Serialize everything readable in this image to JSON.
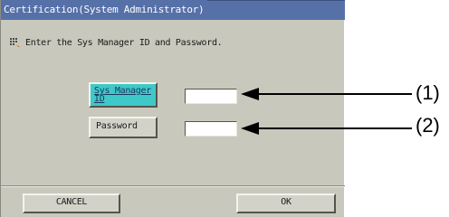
{
  "dialog": {
    "title": "Certification(System Administrator)",
    "message": "Enter the Sys Manager ID and Password."
  },
  "buttons": {
    "sys_manager_id_line1": "Sys Manager",
    "sys_manager_id_line2": "ID",
    "password": "Password",
    "cancel": "CANCEL",
    "ok": "OK"
  },
  "fields": {
    "sys_manager_id_value": "",
    "password_value": ""
  },
  "callouts": [
    "(1)",
    "(2)"
  ],
  "colors": {
    "titlebar": "#5670a8",
    "panel": "#c8c8bc",
    "active_button": "#3fc8c8"
  },
  "icons": {
    "message": "keypad-icon"
  }
}
